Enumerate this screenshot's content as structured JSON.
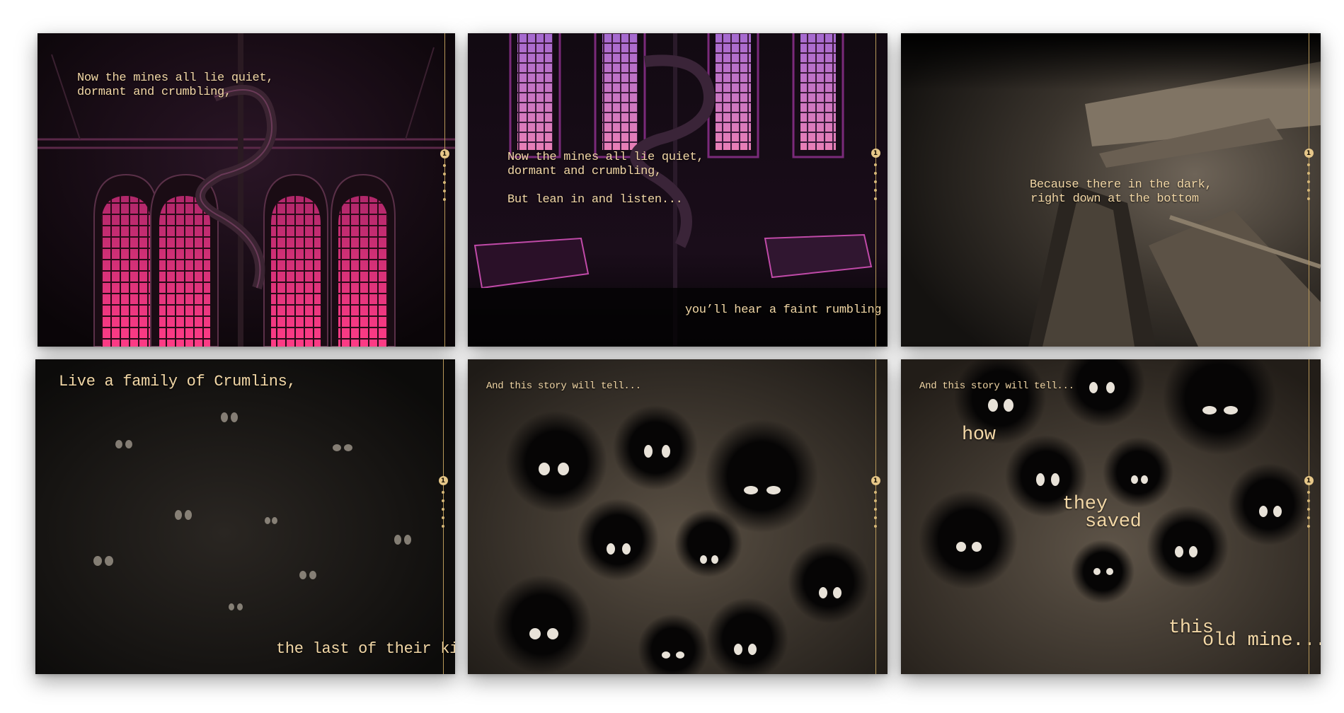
{
  "colors": {
    "accent": "#e6c789",
    "caption": "#f2d7a6",
    "magenta": "#d94aa6",
    "pink_window": "#f0358a",
    "sepia_dark": "#1e1a16",
    "sepia_mid": "#5e554a"
  },
  "panels": [
    {
      "id": "p1",
      "scene": "pink-arched-windows",
      "captions": [
        "Now the mines all lie quiet,\ndormant and crumbling,"
      ],
      "page_indicator": "1"
    },
    {
      "id": "p2",
      "scene": "purple-windows-staircase",
      "captions": [
        "Now the mines all lie quiet,\ndormant and crumbling,\n\nBut lean in and listen...",
        "you’ll hear a faint rumbling"
      ],
      "page_indicator": "1"
    },
    {
      "id": "p3",
      "scene": "mine-tunnel",
      "captions": [
        "Because there in the dark,\nright down at the bottom"
      ],
      "page_indicator": "1"
    },
    {
      "id": "p4",
      "scene": "eyes-in-dark",
      "captions": [
        "Live a family of Crumlins,",
        "the last of their kind..."
      ],
      "page_indicator": "1"
    },
    {
      "id": "p5",
      "scene": "crumlins-gathered",
      "captions": [
        "And this story will tell..."
      ],
      "page_indicator": "1"
    },
    {
      "id": "p6",
      "scene": "crumlins-gathered-close",
      "captions": [
        "And this story will tell...",
        "how",
        "they",
        "saved",
        "this",
        "old mine..."
      ],
      "page_indicator": "1"
    }
  ]
}
